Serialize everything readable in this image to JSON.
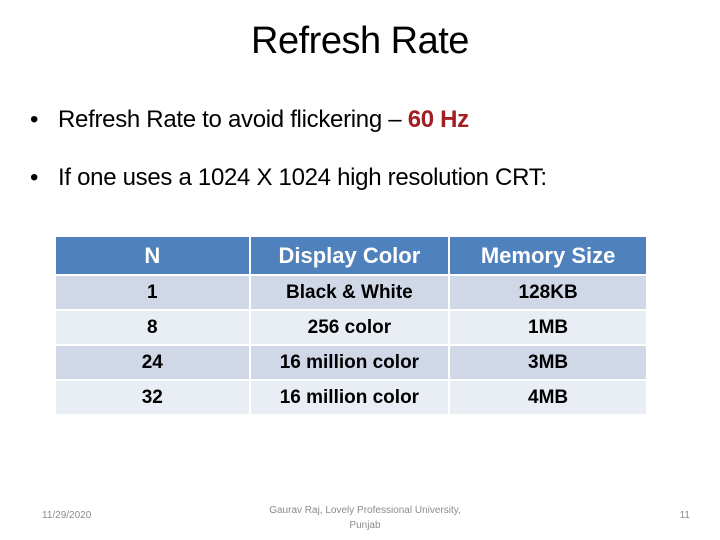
{
  "slide": {
    "title": "Refresh Rate",
    "bullets": [
      {
        "text": "Refresh Rate to avoid flickering – ",
        "highlight": "60 Hz"
      },
      {
        "text": "If one uses a 1024 X 1024 high resolution CRT:"
      }
    ],
    "bullet_glyph": "•",
    "highlight_color": "#a31e22",
    "table": {
      "headers": [
        "N",
        "Display Color",
        "Memory Size"
      ],
      "rows": [
        [
          "1",
          "Black & White",
          "128KB"
        ],
        [
          "8",
          "256 color",
          "1MB"
        ],
        [
          "24",
          "16 million color",
          "3MB"
        ],
        [
          "32",
          "16 million color",
          "4MB"
        ]
      ],
      "header_color": "#4f81bd",
      "row_colors": [
        "#d0d8e8",
        "#e9edf4"
      ]
    },
    "footer": {
      "date": "11/29/2020",
      "author_line1": "Gaurav Raj, Lovely Professional University,",
      "author_line2": "Punjab",
      "page_number": "11"
    }
  }
}
